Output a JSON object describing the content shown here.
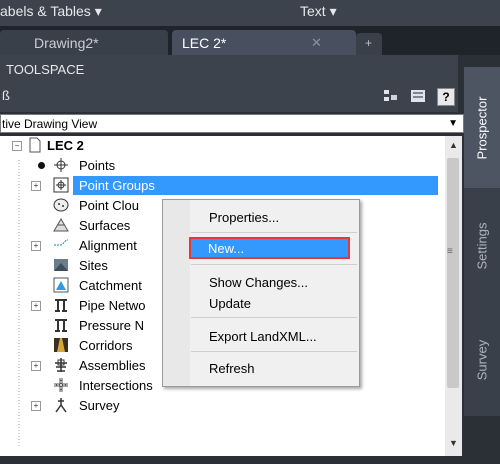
{
  "ribbon": {
    "item1": "abels & Tables ▾",
    "item2": "Text ▾"
  },
  "tabs": {
    "drawing2": "Drawing2*",
    "lec2": "LEC 2*",
    "close": "✕",
    "add": "+"
  },
  "toolspace": {
    "title": "TOOLSPACE",
    "left_glyph": "ß",
    "help": "?"
  },
  "view_select": {
    "value": "tive Drawing View",
    "arrow": "▼"
  },
  "tree": {
    "root": "LEC 2",
    "items": [
      {
        "label": "Points"
      },
      {
        "label": "Point Groups"
      },
      {
        "label": "Point Clou"
      },
      {
        "label": "Surfaces"
      },
      {
        "label": "Alignment"
      },
      {
        "label": "Sites"
      },
      {
        "label": "Catchment"
      },
      {
        "label": "Pipe Netwo"
      },
      {
        "label": "Pressure N"
      },
      {
        "label": "Corridors"
      },
      {
        "label": "Assemblies"
      },
      {
        "label": "Intersections"
      },
      {
        "label": "Survey"
      }
    ]
  },
  "side_tabs": {
    "prospector": "Prospector",
    "settings": "Settings",
    "survey": "Survey"
  },
  "context_menu": {
    "properties": "Properties...",
    "new": "New...",
    "show_changes": "Show Changes...",
    "update": "Update",
    "export": "Export LandXML...",
    "refresh": "Refresh"
  },
  "colors": {
    "selection": "#3399ff",
    "highlight_border": "#e8373a",
    "panel_dark": "#3d434d"
  }
}
